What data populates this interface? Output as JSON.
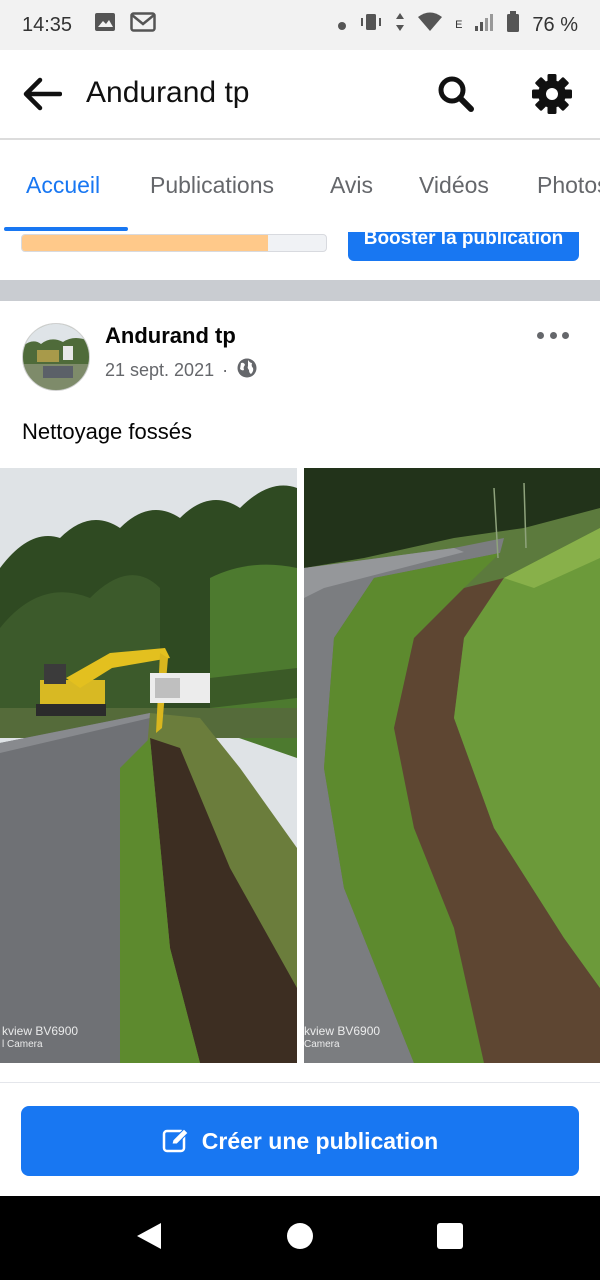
{
  "status_bar": {
    "time": "14:35",
    "battery": "76 %",
    "network_label": "E",
    "icons": [
      "image-icon",
      "gmail-icon",
      "dot-icon",
      "vibrate-icon",
      "data-arrows-icon",
      "wifi-icon",
      "signal-icon",
      "battery-icon"
    ]
  },
  "app_bar": {
    "title": "Andurand tp",
    "icons": [
      "back-arrow-icon",
      "search-icon",
      "gear-icon"
    ]
  },
  "tabs": [
    {
      "label": "Accueil",
      "active": true
    },
    {
      "label": "Publications",
      "active": false
    },
    {
      "label": "Avis",
      "active": false
    },
    {
      "label": "Vidéos",
      "active": false
    },
    {
      "label": "Photos",
      "active": false
    }
  ],
  "promo": {
    "progress": 0.81,
    "progress_color": "#ffc98a",
    "button_label": "Booster la publication"
  },
  "post": {
    "author": "Andurand tp",
    "date": "21 sept. 2021",
    "separator": "·",
    "audience_icon": "globe-icon",
    "text": "Nettoyage fossés",
    "photos": [
      {
        "subject": "excavator digging roadside ditch",
        "watermark_1": "kview BV6900",
        "watermark_2": "l Camera"
      },
      {
        "subject": "cleaned ditch along curved road",
        "watermark_1": "kview BV6900",
        "watermark_2": "Camera"
      }
    ]
  },
  "create_button": {
    "label": "Créer une publication",
    "icon": "edit-icon"
  },
  "nav_bar": {
    "icons": [
      "nav-back-icon",
      "nav-home-icon",
      "nav-recents-icon"
    ]
  },
  "colors": {
    "accent": "#1877f2",
    "text_secondary": "#65676b",
    "divider": "#c9ccd1"
  }
}
